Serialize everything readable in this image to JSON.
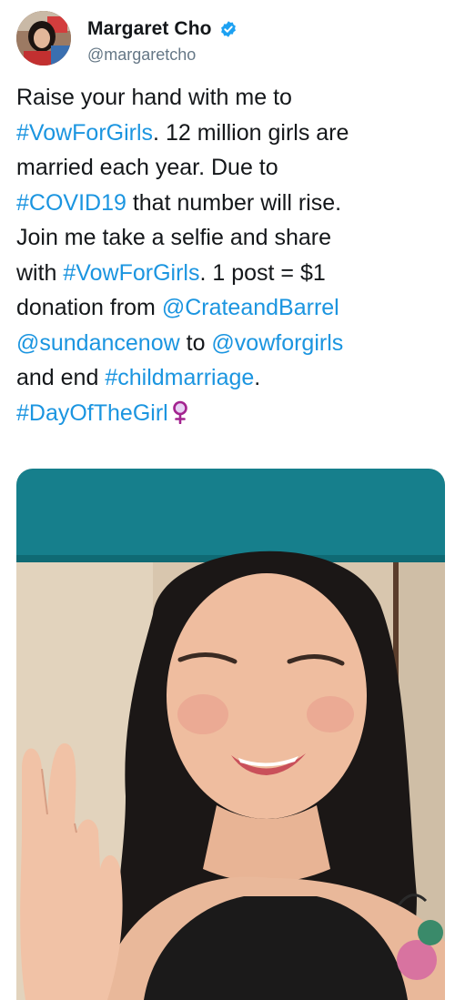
{
  "user": {
    "name": "Margaret Cho",
    "handle": "@margaretcho",
    "verified": true,
    "verified_icon": "verified-badge-icon",
    "verified_color": "#1da1f2"
  },
  "tweet": {
    "link_color": "#1b95e0",
    "emoji": "female-sign-icon",
    "lines": [
      [
        {
          "t": "Raise your hand with me to"
        }
      ],
      [
        {
          "t": "#VowForGirls",
          "l": true
        },
        {
          "t": ". 12 million girls are"
        }
      ],
      [
        {
          "t": "married each year. Due to"
        }
      ],
      [
        {
          "t": "#COVID19",
          "l": true
        },
        {
          "t": " that number will rise."
        }
      ],
      [
        {
          "t": "Join me take a selfie and share"
        }
      ],
      [
        {
          "t": "with "
        },
        {
          "t": "#VowForGirls",
          "l": true
        },
        {
          "t": ". 1 post = $1"
        }
      ],
      [
        {
          "t": "donation from "
        },
        {
          "t": "@CrateandBarrel",
          "l": true
        }
      ],
      [
        {
          "t": "@sundancenow",
          "l": true
        },
        {
          "t": " to "
        },
        {
          "t": "@vowforgirls",
          "l": true
        }
      ],
      [
        {
          "t": "and end "
        },
        {
          "t": "#childmarriage",
          "l": true
        },
        {
          "t": "."
        }
      ],
      [
        {
          "t": "#DayOfTheGirl",
          "l": true
        }
      ]
    ]
  },
  "media": {
    "type": "photo",
    "wall_color": "#167f8c"
  }
}
